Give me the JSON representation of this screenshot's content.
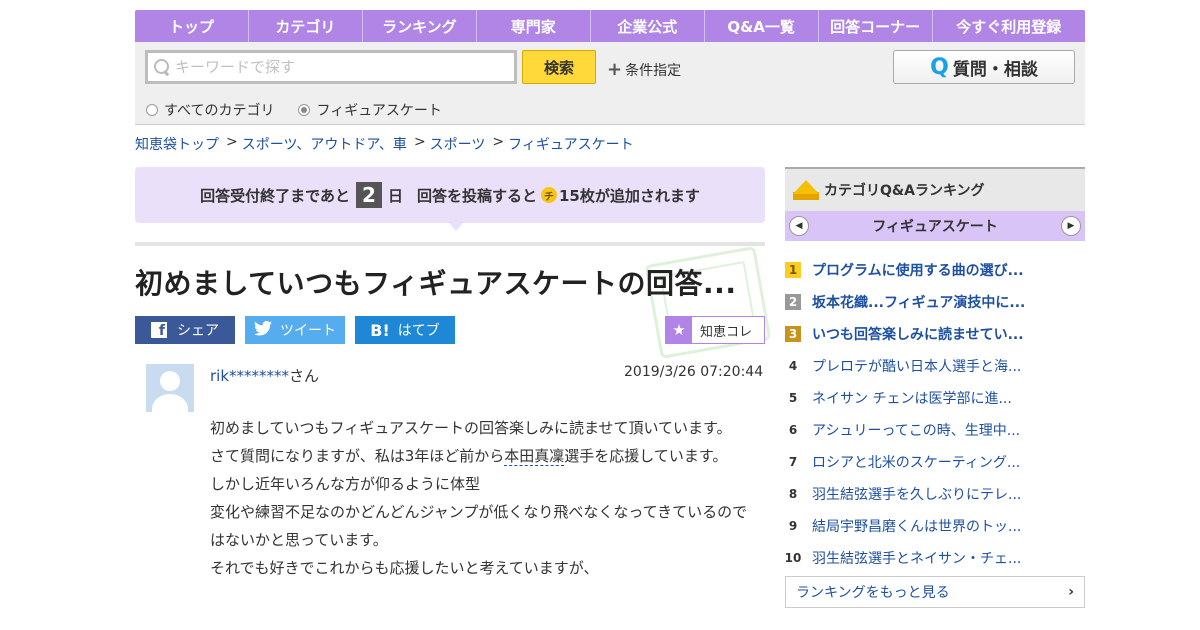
{
  "nav": [
    "トップ",
    "カテゴリ",
    "ランキング",
    "専門家",
    "企業公式",
    "Q&A一覧",
    "回答コーナー",
    "今すぐ利用登録"
  ],
  "search": {
    "placeholder": "キーワードで探す",
    "button": "検索",
    "conditions": "条件指定",
    "ask_button": "質問・相談",
    "ask_icon": "Q",
    "radio_all": "すべてのカテゴリ",
    "radio_current": "フィギュアスケート",
    "selected": "フィギュアスケート"
  },
  "breadcrumb": [
    "知恵袋トップ",
    "スポーツ、アウトドア、車",
    "スポーツ",
    "フィギュアスケート"
  ],
  "breadcrumb_sep": ">",
  "notice": {
    "prefix": "回答受付終了まであと",
    "days": "2",
    "days_unit": "日",
    "middle": "回答を投稿すると",
    "coin": "チ",
    "suffix": "15枚が追加されます"
  },
  "question": {
    "title": "初めましていつもフィギュアスケートの回答...",
    "share": {
      "facebook": "シェア",
      "twitter": "ツイート",
      "hatena": "はてブ",
      "hatena_icon": "B!",
      "fb_icon": "f"
    },
    "chiekore": "知恵コレ",
    "user": "rik********",
    "user_suffix": "さん",
    "date": "2019/3/26  07:20:44",
    "body": {
      "l1": "初めましていつもフィギュアスケートの回答楽しみに読ませて頂いています。",
      "l2a": "さて質問になりますが、私は3年ほど前から",
      "l2link": "本田真凜",
      "l2b": "選手を応援しています。",
      "l3": "しかし近年いろんな方が仰るように体型",
      "l4": "変化や練習不足なのかどんどんジャンプが低くなり飛べなくなってきているのではないかと思っています。",
      "l5": "それでも好きでこれからも応援したいと考えていますが、"
    }
  },
  "ranking": {
    "title": "カテゴリQ&Aランキング",
    "category": "フィギュアスケート",
    "items": [
      {
        "rank": "1",
        "text": "プログラムに使用する曲の選び..."
      },
      {
        "rank": "2",
        "text": "坂本花織...フィギュア演技中に..."
      },
      {
        "rank": "3",
        "text": "いつも回答楽しみに読ませてい..."
      },
      {
        "rank": "4",
        "text": "プレロテが酷い日本人選手と海..."
      },
      {
        "rank": "5",
        "text": "ネイサン チェンは医学部に進..."
      },
      {
        "rank": "6",
        "text": "アシュリーってこの時、生理中..."
      },
      {
        "rank": "7",
        "text": "ロシアと北米のスケーティング..."
      },
      {
        "rank": "8",
        "text": "羽生結弦選手を久しぶりにテレ..."
      },
      {
        "rank": "9",
        "text": "結局宇野昌磨くんは世界のトッ..."
      },
      {
        "rank": "10",
        "text": "羽生結弦選手とネイサン・チェ..."
      }
    ],
    "more": "ランキングをもっと見る"
  }
}
